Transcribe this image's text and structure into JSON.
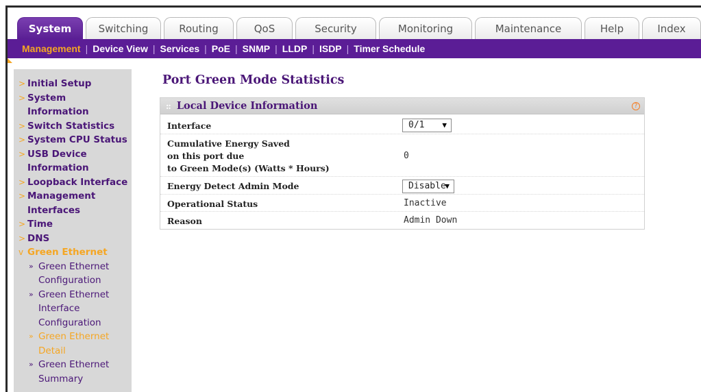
{
  "tabs": [
    {
      "label": "System",
      "active": true
    },
    {
      "label": "Switching",
      "active": false
    },
    {
      "label": "Routing",
      "active": false
    },
    {
      "label": "QoS",
      "active": false
    },
    {
      "label": "Security",
      "active": false
    },
    {
      "label": "Monitoring",
      "active": false
    },
    {
      "label": "Maintenance",
      "active": false
    },
    {
      "label": "Help",
      "active": false
    },
    {
      "label": "Index",
      "active": false
    }
  ],
  "submenu": [
    {
      "label": "Management",
      "active": true
    },
    {
      "label": "Device View",
      "active": false
    },
    {
      "label": "Services",
      "active": false
    },
    {
      "label": "PoE",
      "active": false
    },
    {
      "label": "SNMP",
      "active": false
    },
    {
      "label": "LLDP",
      "active": false
    },
    {
      "label": "ISDP",
      "active": false
    },
    {
      "label": "Timer Schedule",
      "active": false
    }
  ],
  "sidebar": {
    "items": [
      {
        "label": "Initial Setup"
      },
      {
        "label": "System Information"
      },
      {
        "label": "Switch Statistics"
      },
      {
        "label": "System CPU Status"
      },
      {
        "label": "USB Device Information"
      },
      {
        "label": "Loopback Interface"
      },
      {
        "label": "Management Interfaces"
      },
      {
        "label": "Time"
      },
      {
        "label": "DNS"
      },
      {
        "label": "Green Ethernet"
      }
    ],
    "subitems": [
      {
        "label": "Green Ethernet Configuration"
      },
      {
        "label": "Green Ethernet Interface Configuration"
      },
      {
        "label": "Green Ethernet Detail"
      },
      {
        "label": "Green Ethernet Summary"
      }
    ]
  },
  "page": {
    "title": "Port Green Mode Statistics",
    "panel_title": "Local Device Information",
    "help_glyph": "?"
  },
  "fields": {
    "interface_label": "Interface",
    "interface_value": "0/1",
    "energy_label_1": "Cumulative Energy Saved",
    "energy_label_2": "on this port due",
    "energy_label_3": "to Green Mode(s) (Watts * Hours)",
    "energy_value": "0",
    "edam_label": "Energy Detect Admin Mode",
    "edam_value": "Disable",
    "opstatus_label": "Operational Status",
    "opstatus_value": "Inactive",
    "reason_label": "Reason",
    "reason_value": "Admin Down"
  },
  "colors": {
    "brand_purple": "#5b1d96",
    "accent_orange": "#f5a623",
    "sidebar_bg": "#d8d8d8"
  }
}
